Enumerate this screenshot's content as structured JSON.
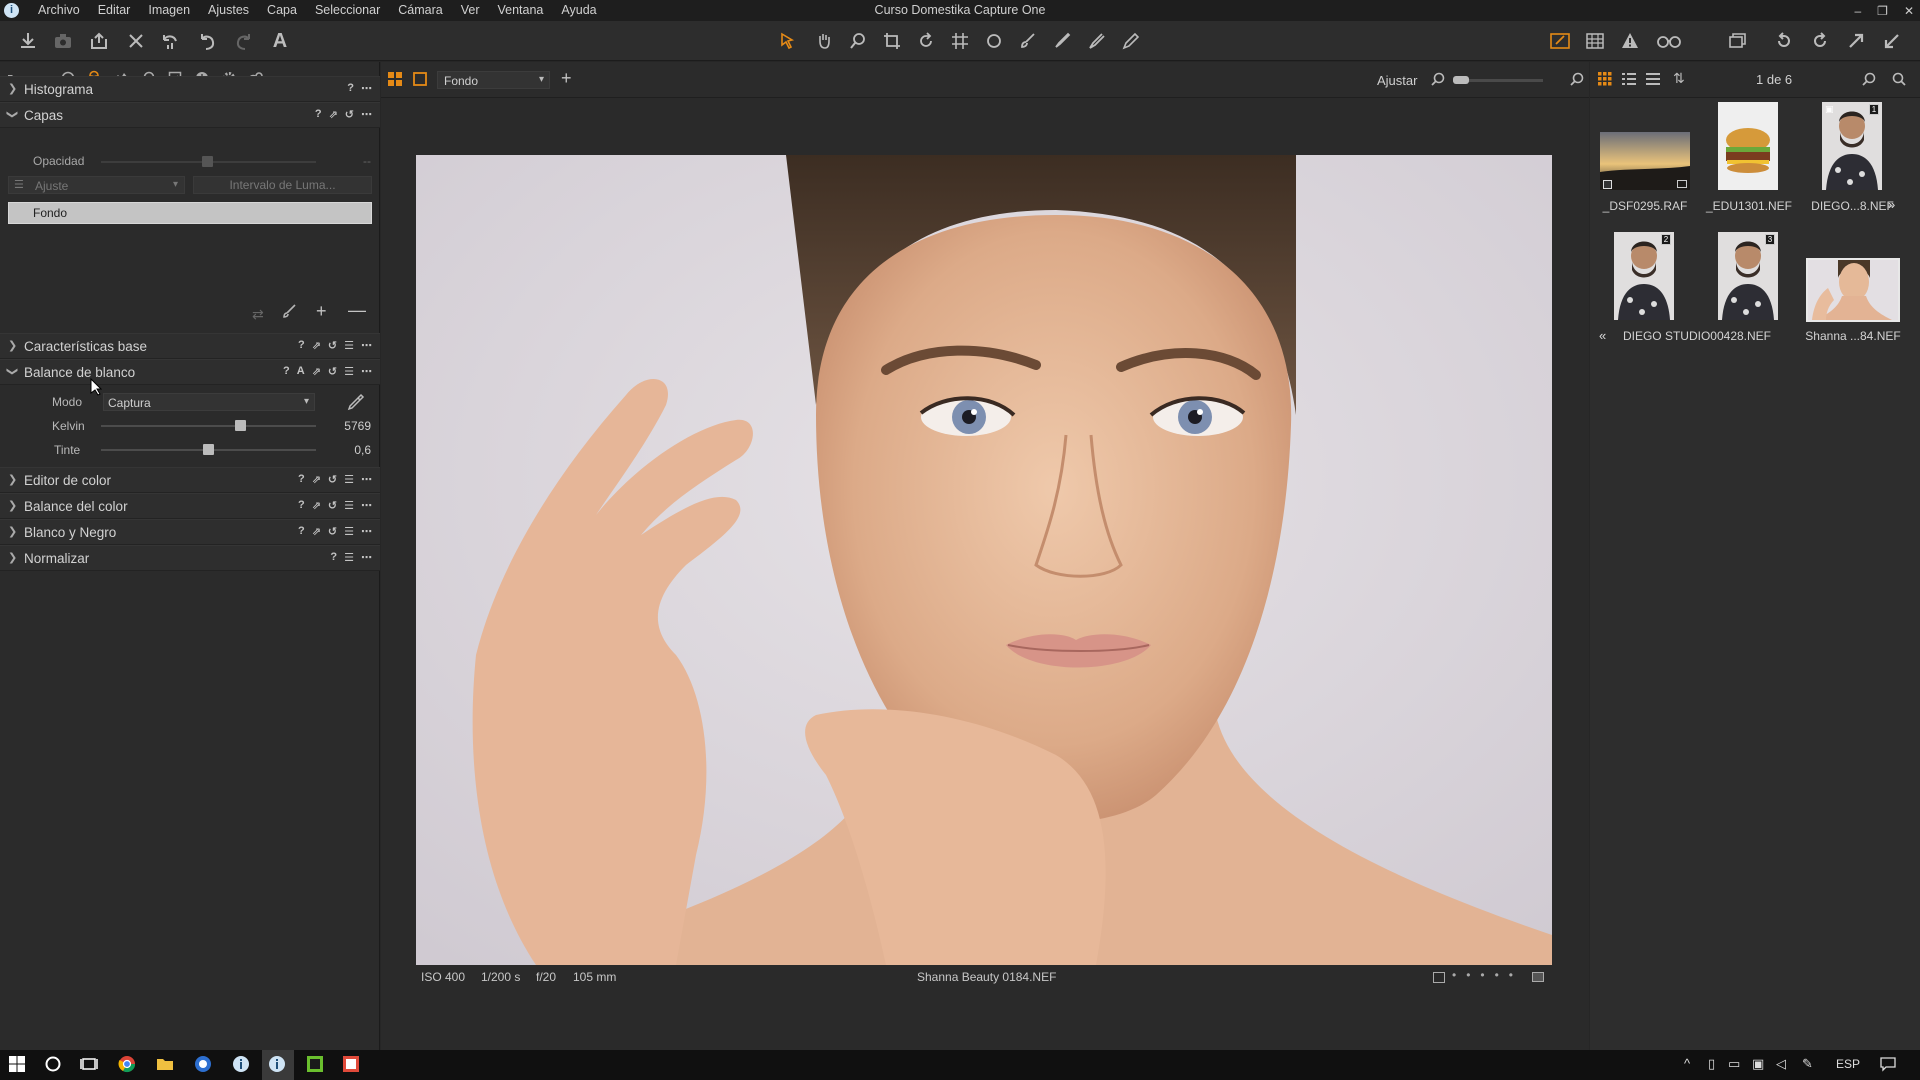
{
  "window": {
    "title": "Curso Domestika Capture One",
    "controls": [
      "–",
      "❐",
      "✕"
    ]
  },
  "menu": [
    "Archivo",
    "Editar",
    "Imagen",
    "Ajustes",
    "Capa",
    "Seleccionar",
    "Cámara",
    "Ver",
    "Ventana",
    "Ayuda"
  ],
  "colors": {
    "accent": "#e58a16",
    "panel": "#2b2b2b",
    "selected_layer": "#c4c4c4",
    "logo_red": "#e0001a"
  },
  "toolbar": {
    "left_icons": [
      "import-icon",
      "camera-icon",
      "export-icon",
      "delete-icon",
      "undo-history-icon",
      "undo-icon",
      "redo-icon",
      "text-icon"
    ],
    "center_icons": [
      "cursor-icon",
      "pan-icon",
      "zoom-icon",
      "crop-icon",
      "rotate-icon",
      "keystone-icon",
      "spot-icon",
      "brush-icon",
      "erase-icon",
      "gradient-icon",
      "eraser-icon"
    ],
    "right_icons": [
      "edit-mode-icon",
      "grid-icon",
      "warning-icon",
      "glasses-icon",
      "copy-icon",
      "rotate-left-icon",
      "rotate-right-icon",
      "copy-adjustments-icon",
      "apply-adjustments-icon"
    ]
  },
  "left_panel": {
    "tab_icons": [
      "folder-icon",
      "camera-icon",
      "lens-icon",
      "color-icon",
      "exposure-icon",
      "details-icon",
      "meta-icon",
      "info-icon",
      "settings-icon",
      "plugins-icon"
    ],
    "histogram": {
      "title": "Histograma"
    },
    "layers": {
      "title": "Capas",
      "opacity_label": "Opacidad",
      "opacity_value": "--",
      "adjust_select": "Ajuste",
      "luma_button": "Intervalo de Luma...",
      "items": [
        "Fondo"
      ]
    },
    "base_characteristics": {
      "title": "Características base"
    },
    "white_balance": {
      "title": "Balance de blanco",
      "mode_label": "Modo",
      "mode_value": "Captura",
      "kelvin_label": "Kelvin",
      "kelvin_value": "5769",
      "kelvin_fraction": 0.65,
      "tint_label": "Tinte",
      "tint_value": "0,6",
      "tint_fraction": 0.5
    },
    "tools": [
      "Editor de color",
      "Balance del color",
      "Blanco y Negro",
      "Normalizar"
    ]
  },
  "viewer": {
    "layer_select": "Fondo",
    "fit_label": "Ajustar",
    "iso": "ISO 400",
    "shutter": "1/200 s",
    "aperture": "f/20",
    "focal": "105 mm",
    "filename": "Shanna Beauty 0184.NEF"
  },
  "browser": {
    "counter": "1 de 6",
    "thumbs": [
      {
        "name": "_DSF0295.RAF",
        "kind": "landscape"
      },
      {
        "name": "_EDU1301.NEF",
        "kind": "burger"
      },
      {
        "name": "DIEGO...8.NEF",
        "kind": "man",
        "badge": "1"
      },
      {
        "name": "",
        "kind": "man",
        "badge": "2"
      },
      {
        "name": "DIEGO STUDIO00428.NEF",
        "kind": "man",
        "badge": "3"
      },
      {
        "name": "Shanna ...84.NEF",
        "kind": "woman"
      }
    ],
    "stack_arrows": [
      "»",
      "«"
    ]
  },
  "taskbar": {
    "lang": "ESP"
  }
}
